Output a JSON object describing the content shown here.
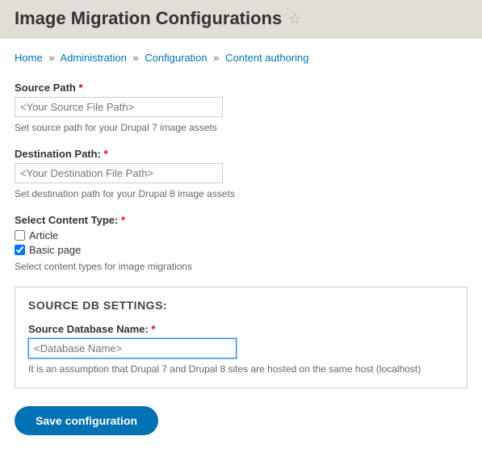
{
  "header": {
    "title": "Image Migration Configurations"
  },
  "breadcrumb": {
    "items": [
      "Home",
      "Administration",
      "Configuration",
      "Content authoring"
    ],
    "sep": "»"
  },
  "form": {
    "source_path": {
      "label": "Source Path",
      "placeholder": "<Your Source File Path>",
      "description": "Set source path for your Drupal 7 image assets"
    },
    "destination_path": {
      "label": "Destination Path:",
      "placeholder": "<Your Destination File Path>",
      "description": "Set destination path for your Drupal 8 image assets"
    },
    "content_type": {
      "label": "Select Content Type:",
      "options": {
        "article": "Article",
        "basic_page": "Basic page"
      },
      "description": "Select content types for image migrations"
    },
    "db": {
      "legend": "SOURCE DB SETTINGS:",
      "name_label": "Source Database Name:",
      "name_placeholder": "<Database Name>",
      "description": "It is an assumption that Drupal 7 and Drupal 8 sites are hosted on the same host (localhost)"
    },
    "submit_label": "Save configuration"
  },
  "required_marker": "*"
}
